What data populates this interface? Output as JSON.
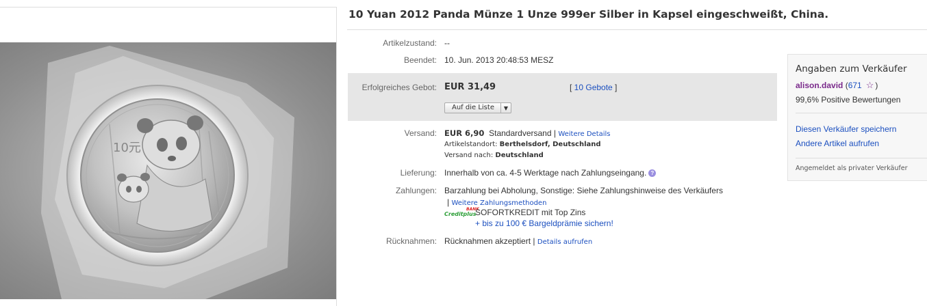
{
  "listing": {
    "title": "10 Yuan 2012 Panda Münze 1 Unze 999er Silber in Kapsel eingeschweißt, China."
  },
  "details": {
    "condition_label": "Artikelzustand:",
    "condition_value": "--",
    "ended_label": "Beendet:",
    "ended_value": "10. Jun. 2013  20:48:53 MESZ",
    "bid_label": "Erfolgreiches Gebot:",
    "bid_price": "EUR 31,49",
    "bids_open": "[ ",
    "bids_link": "10 Gebote",
    "bids_close": " ]",
    "watch_button": "Auf die Liste",
    "shipping_label": "Versand:",
    "shipping_price": "EUR 6,90",
    "shipping_method": "Standardversand",
    "shipping_sep": " | ",
    "shipping_more": "Weitere Details",
    "location_label": "Artikelstandort:",
    "location_value": "Berthelsdorf, Deutschland",
    "ships_to_label": "Versand nach:",
    "ships_to_value": "Deutschland",
    "delivery_label": "Lieferung:",
    "delivery_value": "Innerhalb von ca. 4-5 Werktage nach Zahlungseingang.",
    "payment_label": "Zahlungen:",
    "payment_value": "Barzahlung bei Abholung,  Sonstige: Siehe Zahlungshinweise des Verkäufers",
    "payment_sep": "| ",
    "payment_more": "Weitere Zahlungsmethoden",
    "creditplus_logo": "Creditplus",
    "creditplus_tag": "BANK",
    "sofortkredit": "SOFORTKREDIT mit Top Zins",
    "bargeld": "+ bis zu 100 € Bargeldprämie sichern!",
    "returns_label": "Rücknahmen:",
    "returns_value": "Rücknahmen akzeptiert",
    "returns_sep": " | ",
    "returns_more": "Details aufrufen"
  },
  "seller": {
    "heading": "Angaben zum Verkäufer",
    "username": "alison.david",
    "score_open": " (",
    "score": "671",
    "score_close": ")",
    "positive": "99,6% Positive Bewertungen",
    "save_link": "Diesen Verkäufer speichern",
    "other_items_link": "Andere Artikel aufrufen",
    "private_note": "Angemeldet als privater Verkäufer"
  },
  "photo": {
    "coin_denomination": "10元"
  },
  "colors": {
    "link": "#1b4fbf",
    "seller_name": "#7a2a8b",
    "bid_box": "#e6e6e6",
    "creditplus_green": "#2a9d35"
  }
}
